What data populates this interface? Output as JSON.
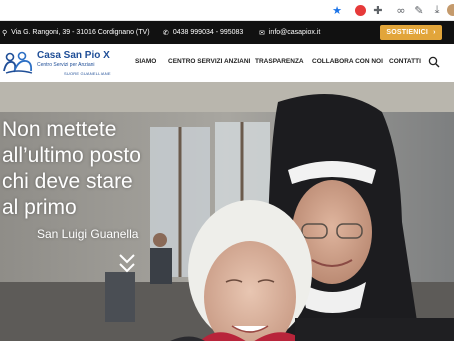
{
  "browser": {
    "icons": [
      "star-icon",
      "extension-red-icon",
      "puzzle-icon",
      "link-icon",
      "edit-icon",
      "download-icon",
      "avatar-icon"
    ]
  },
  "topbar": {
    "address": "Via G. Rangoni, 39 - 31016 Cordignano (TV)",
    "phone": "0438 999034 - 995083",
    "email": "info@casapiox.it",
    "support_label": "SOSTIENICI",
    "support_color": "#e2a53a"
  },
  "logo": {
    "name": "Casa San Pio X",
    "subtitle": "Centro Servizi per Anziani",
    "tagline": "SUORE GUANELLIANE"
  },
  "nav": {
    "items": [
      "SIAMO",
      "CENTRO SERVIZI ANZIANI",
      "TRASPARENZA",
      "COLLABORA CON NOI",
      "CONTATTI"
    ]
  },
  "hero": {
    "title_lines": [
      "Non mettete",
      "all’ultimo posto",
      "chi deve stare",
      "al primo"
    ],
    "author": "San Luigi Guanella"
  },
  "colors": {
    "brand_blue": "#1f4e97",
    "topbar_bg": "#111111",
    "accent": "#e2a53a"
  }
}
